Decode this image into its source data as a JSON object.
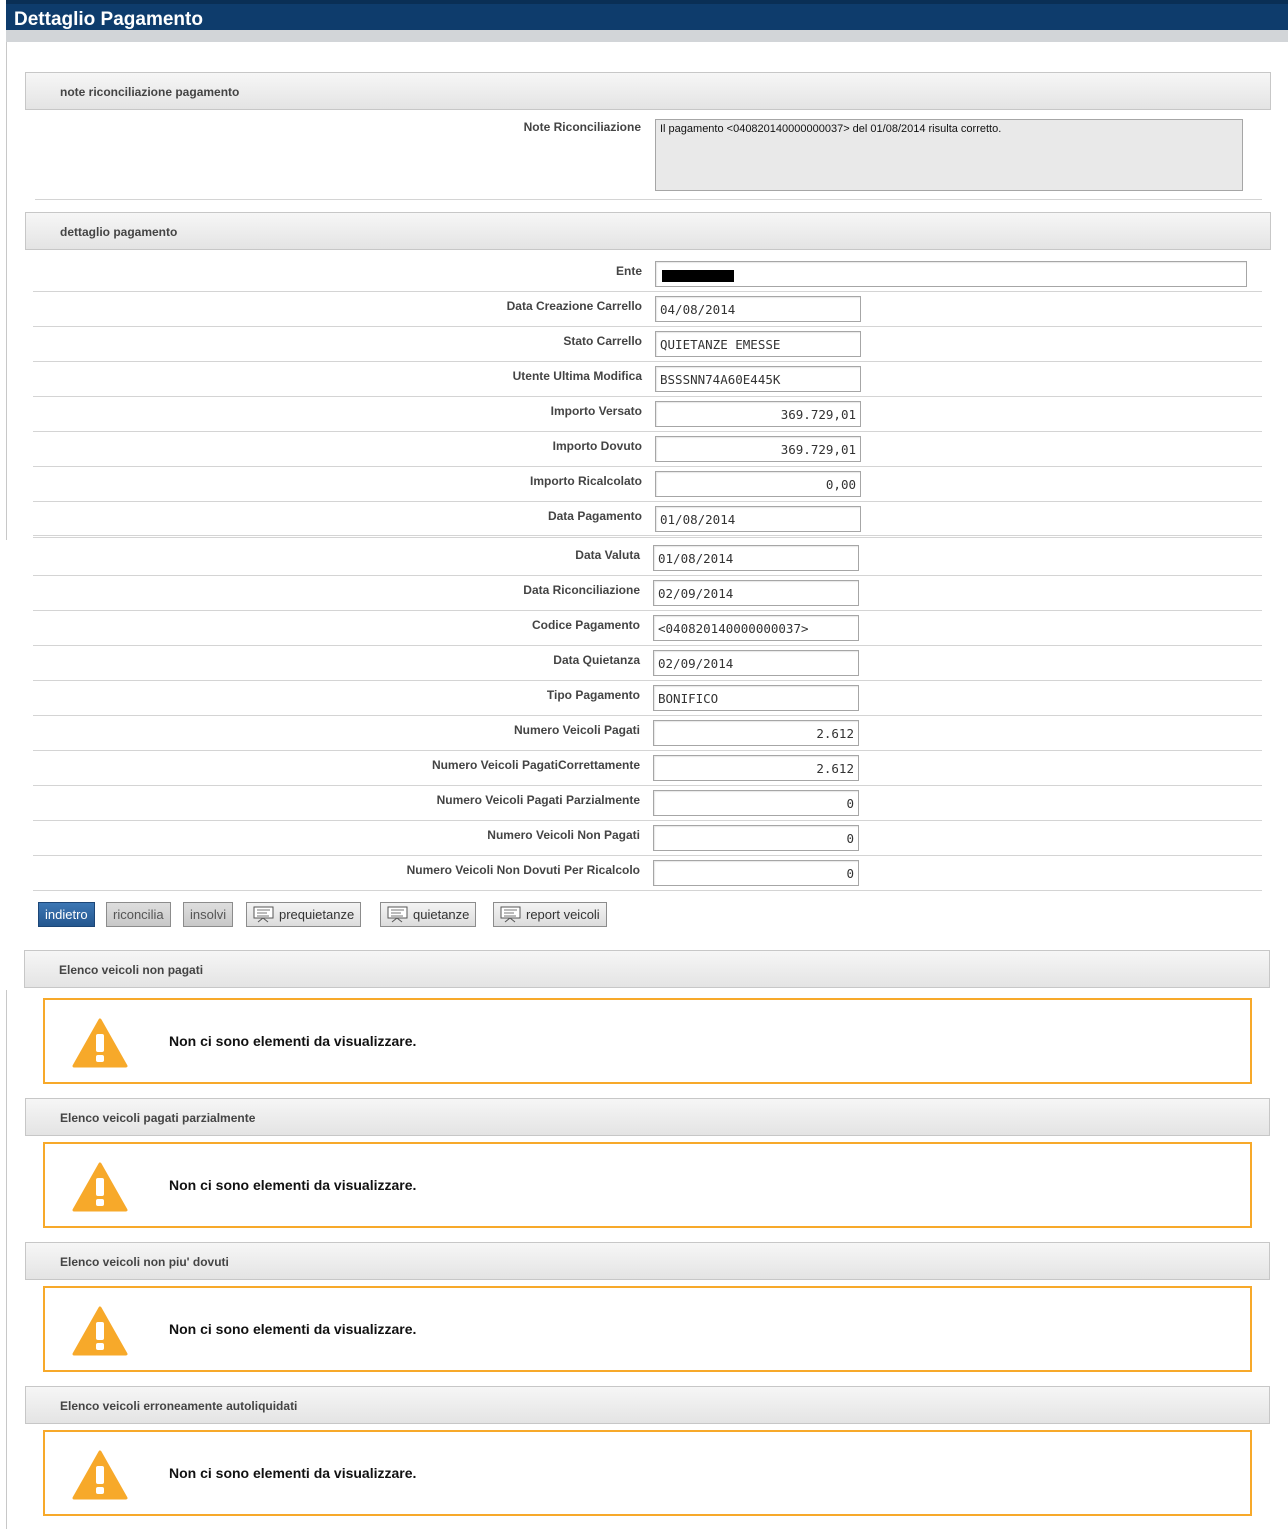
{
  "header": {
    "title": "Dettaglio Pagamento"
  },
  "notes_section": {
    "title": "note riconciliazione pagamento",
    "label": "Note Riconciliazione",
    "text": "Il pagamento <040820140000000037> del 01/08/2014 risulta corretto."
  },
  "detail_section": {
    "title": "dettaglio pagamento",
    "fields": [
      {
        "label": "Ente",
        "value": ""
      },
      {
        "label": "Data Creazione Carrello",
        "value": "04/08/2014"
      },
      {
        "label": "Stato Carrello",
        "value": "QUIETANZE EMESSE"
      },
      {
        "label": "Utente Ultima Modifica",
        "value": "BSSSNN74A60E445K"
      },
      {
        "label": "Importo Versato",
        "value": "369.729,01"
      },
      {
        "label": "Importo Dovuto",
        "value": "369.729,01"
      },
      {
        "label": "Importo Ricalcolato",
        "value": "0,00"
      },
      {
        "label": "Data Pagamento",
        "value": "01/08/2014"
      },
      {
        "label": "Data Valuta",
        "value": "01/08/2014"
      },
      {
        "label": "Data Riconciliazione",
        "value": "02/09/2014"
      },
      {
        "label": "Codice Pagamento",
        "value": "<040820140000000037>"
      },
      {
        "label": "Data Quietanza",
        "value": "02/09/2014"
      },
      {
        "label": "Tipo Pagamento",
        "value": "BONIFICO"
      },
      {
        "label": "Numero Veicoli Pagati",
        "value": "2.612"
      },
      {
        "label": "Numero Veicoli PagatiCorrettamente",
        "value": "2.612"
      },
      {
        "label": "Numero Veicoli Pagati Parzialmente",
        "value": "0"
      },
      {
        "label": "Numero Veicoli Non Pagati",
        "value": "0"
      },
      {
        "label": "Numero Veicoli Non Dovuti Per Ricalcolo",
        "value": "0"
      }
    ]
  },
  "buttons": {
    "indietro": "indietro",
    "riconcilia": "riconcilia",
    "insolvi": "insolvi",
    "prequietanze": "prequietanze",
    "quietanze": "quietanze",
    "report_veicoli": "report veicoli"
  },
  "lists": [
    {
      "title": "Elenco veicoli non pagati",
      "message": "Non ci sono elementi da visualizzare."
    },
    {
      "title": "Elenco veicoli pagati parzialmente",
      "message": "Non ci sono elementi da visualizzare."
    },
    {
      "title": "Elenco veicoli non piu' dovuti",
      "message": "Non ci sono elementi da visualizzare."
    },
    {
      "title": "Elenco veicoli erroneamente autoliquidati",
      "message": "Non ci sono elementi da visualizzare."
    }
  ],
  "colors": {
    "title_bar": "#0e3c6c",
    "warning_border": "#f7a92a",
    "warning_icon": "#f7a92a",
    "primary_button": "#2c63a0"
  }
}
